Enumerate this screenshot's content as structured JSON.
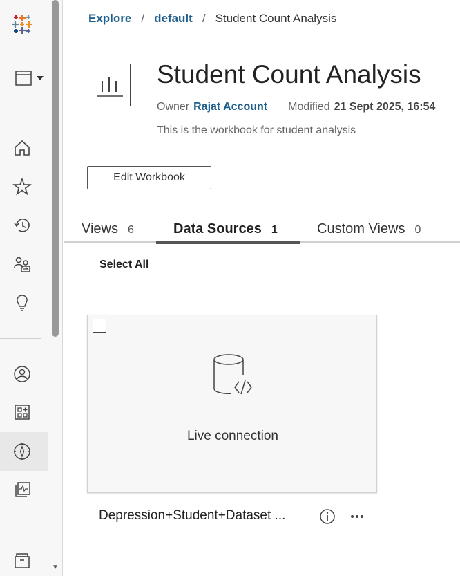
{
  "breadcrumb": {
    "explore": "Explore",
    "project": "default",
    "separator": "/",
    "current": "Student Count Analysis"
  },
  "workbook": {
    "title": "Student Count Analysis",
    "owner_label": "Owner",
    "owner": "Rajat Account",
    "modified_label": "Modified",
    "modified": "21 Sept 2025, 16:54",
    "description": "This is the workbook for student analysis",
    "edit_button": "Edit Workbook"
  },
  "tabs": [
    {
      "label": "Views",
      "count": "6",
      "active": false
    },
    {
      "label": "Data Sources",
      "count": "1",
      "active": true
    },
    {
      "label": "Custom Views",
      "count": "0",
      "active": false
    }
  ],
  "select_all": "Select All",
  "datasource": {
    "connection": "Live connection",
    "name": "Depression+Student+Dataset ..."
  },
  "sidebar": {
    "icons": [
      "tableau-logo-icon",
      "window-menu-icon",
      "home-icon",
      "star-icon",
      "recent-icon",
      "shared-icon",
      "recommendations-icon",
      "personal-space-icon",
      "collections-icon",
      "explore-icon",
      "metrics-icon",
      "archive-icon"
    ]
  },
  "colors": {
    "link": "#1f5f8b",
    "sidebar_bg": "#f7f7f7"
  }
}
